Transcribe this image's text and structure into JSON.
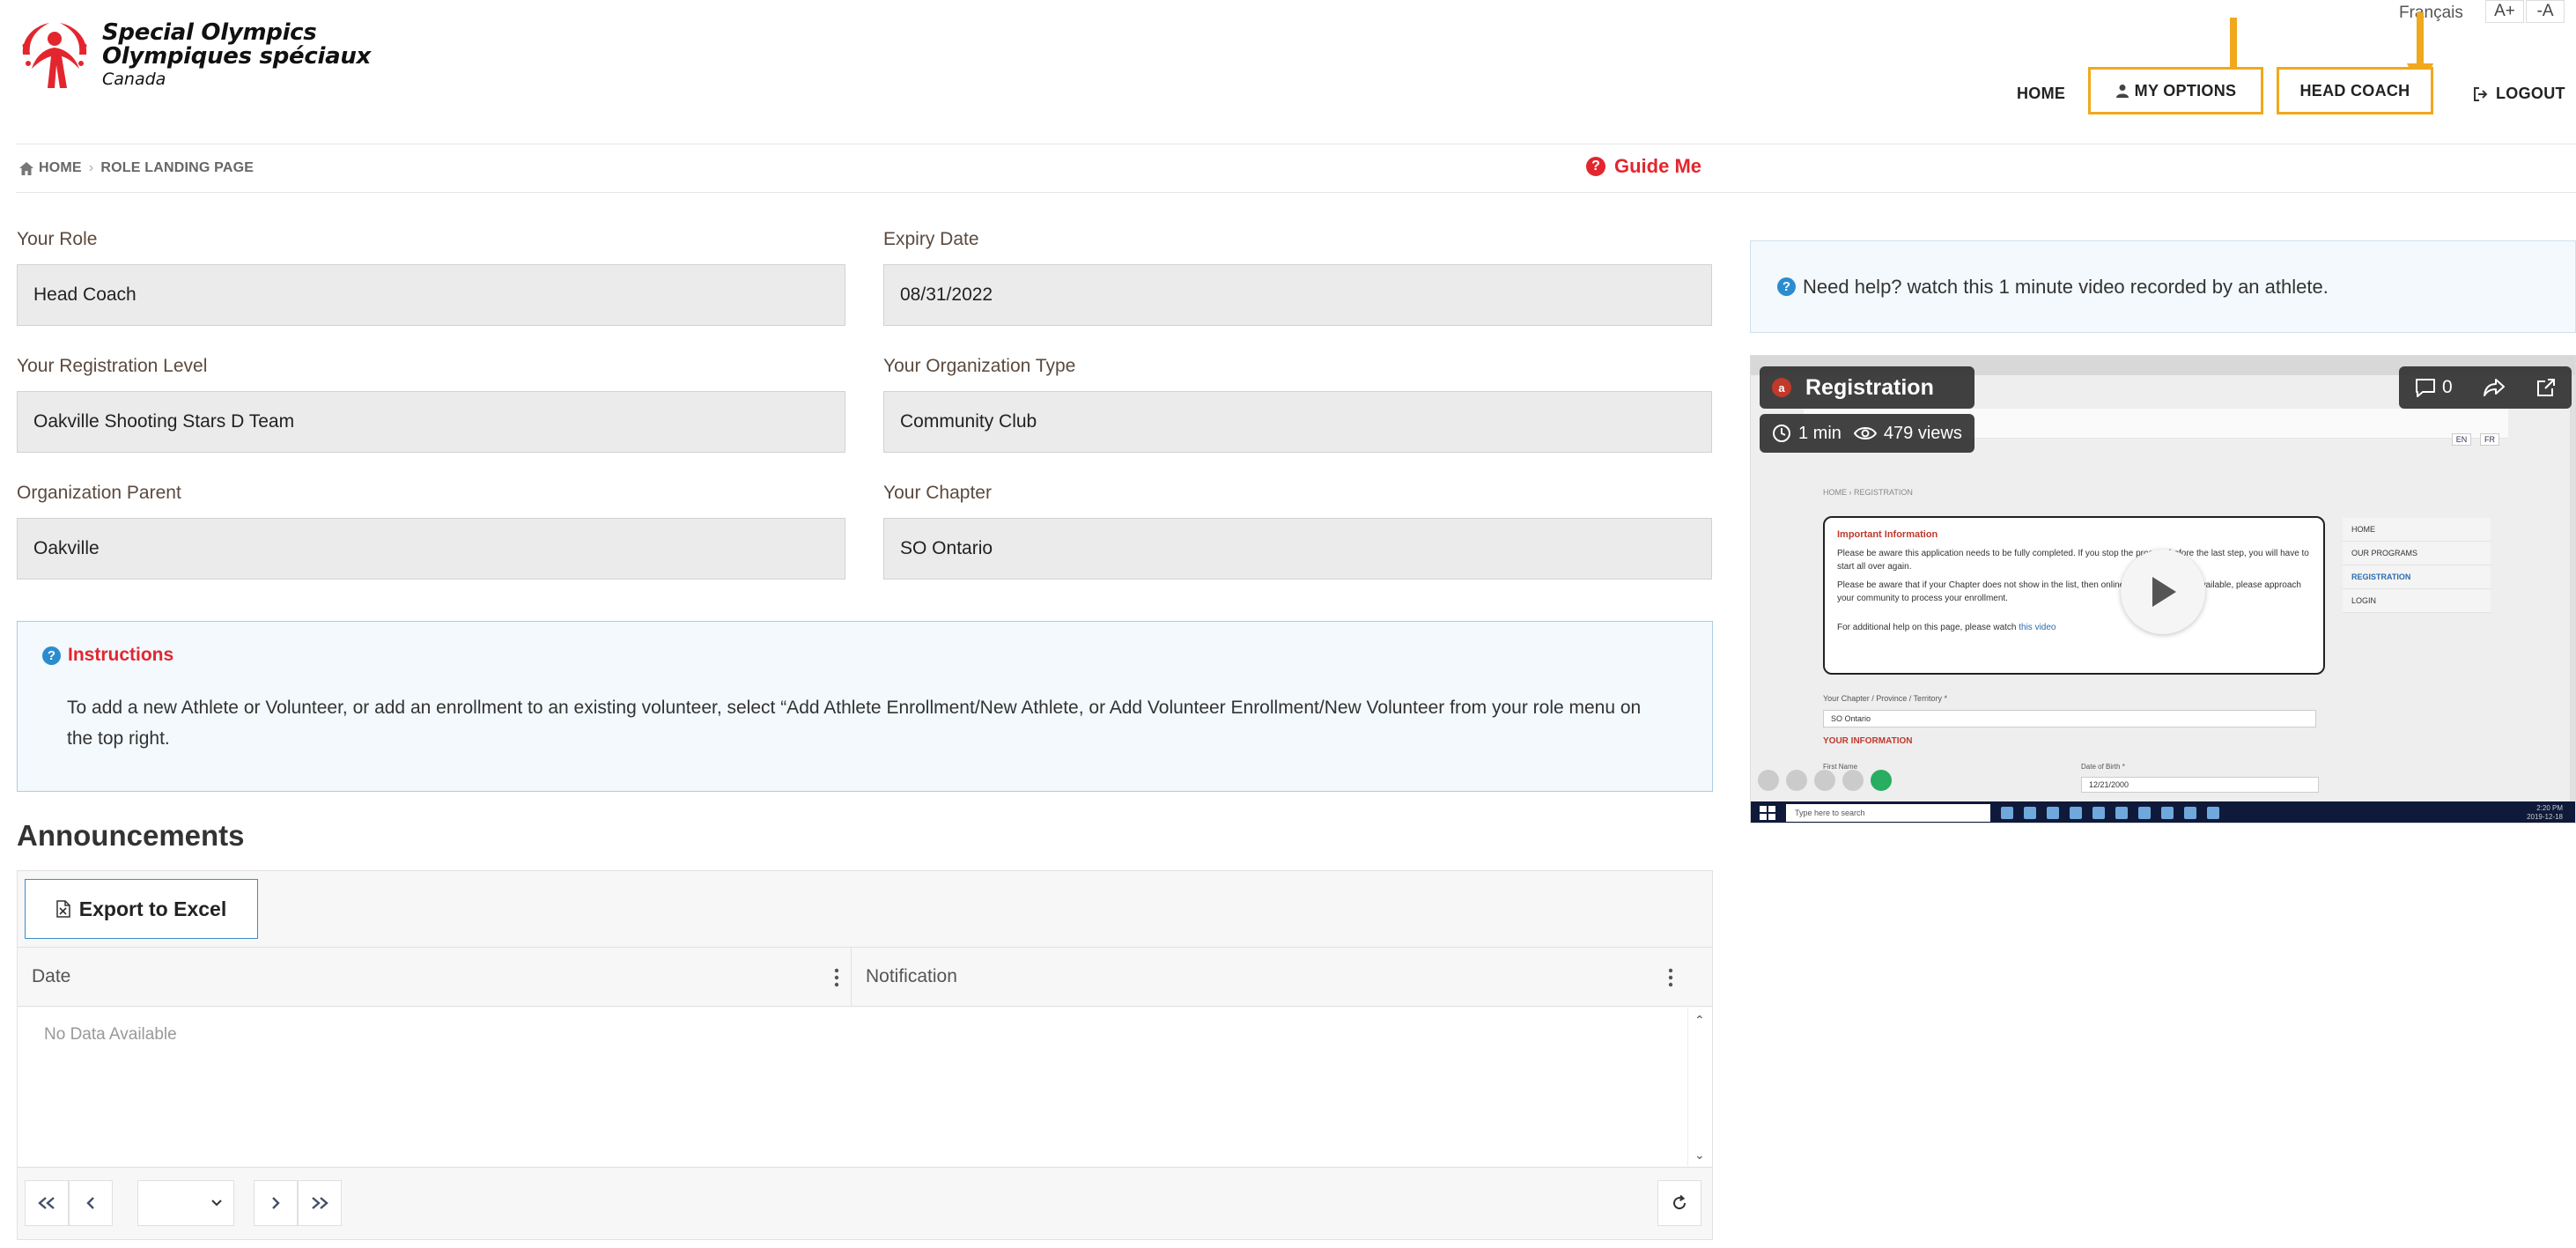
{
  "brand": {
    "line1": "Special Olympics",
    "line2": "Olympiques spéciaux",
    "line3": "Canada"
  },
  "top": {
    "language": "Français",
    "font_up": "A+",
    "font_down": "-A"
  },
  "nav": {
    "home": "HOME",
    "my_options": "MY OPTIONS",
    "head_coach": "HEAD COACH",
    "logout": "LOGOUT"
  },
  "breadcrumb": {
    "home": "HOME",
    "current": "ROLE LANDING PAGE"
  },
  "guide_me": "Guide Me",
  "fields": {
    "role": {
      "label": "Your Role",
      "value": "Head Coach"
    },
    "expiry": {
      "label": "Expiry Date",
      "value": "08/31/2022"
    },
    "reg_level": {
      "label": "Your Registration Level",
      "value": "Oakville Shooting Stars D Team"
    },
    "org_type": {
      "label": "Your Organization Type",
      "value": "Community Club"
    },
    "org_parent": {
      "label": "Organization Parent",
      "value": "Oakville"
    },
    "chapter": {
      "label": "Your Chapter",
      "value": "SO Ontario"
    }
  },
  "instructions": {
    "title": "Instructions",
    "text": "To add a new Athlete or Volunteer, or add an enrollment to an existing volunteer, select “Add Athlete Enrollment/New Athlete, or Add Volunteer Enrollment/New Volunteer from your role menu on the top right."
  },
  "announcements": {
    "title": "Announcements",
    "export_label": "Export to Excel",
    "columns": [
      "Date",
      "Notification"
    ],
    "empty_text": "No Data Available"
  },
  "help": {
    "text": "Need help? watch this 1 minute video recorded by an athlete."
  },
  "video": {
    "title": "Registration",
    "badge": "a",
    "duration": "1 min",
    "views": "479 views",
    "comments": "0",
    "lang_en": "EN",
    "lang_fr": "FR",
    "inner_crumb": "HOME › REGISTRATION",
    "info_title": "Important Information",
    "info_p1": "Please be aware this application needs to be fully completed. If you stop the process before the last step, you will have to start all over again.",
    "info_p2": "Please be aware that if your Chapter does not show in the list, then online registration is not available, please approach your community to process your enrollment.",
    "info_p3_pre": "For additional help on this page, please watch",
    "info_p3_link": "this video",
    "menu": [
      "HOME",
      "OUR PROGRAMS",
      "REGISTRATION",
      "LOGIN"
    ],
    "chapter_label": "Your Chapter / Province / Territory *",
    "chapter_value": "SO Ontario",
    "your_info": "YOUR INFORMATION",
    "first_name": "First Name",
    "dob_label": "Date of Birth *",
    "dob_value": "12/21/2000",
    "taskbar_search": "Type here to search",
    "clock_time": "2:20 PM",
    "clock_date": "2019-12-18"
  },
  "colors": {
    "accent_red": "#e3262e",
    "highlight_orange": "#f0a81c",
    "info_blue": "#2b8ccf"
  }
}
